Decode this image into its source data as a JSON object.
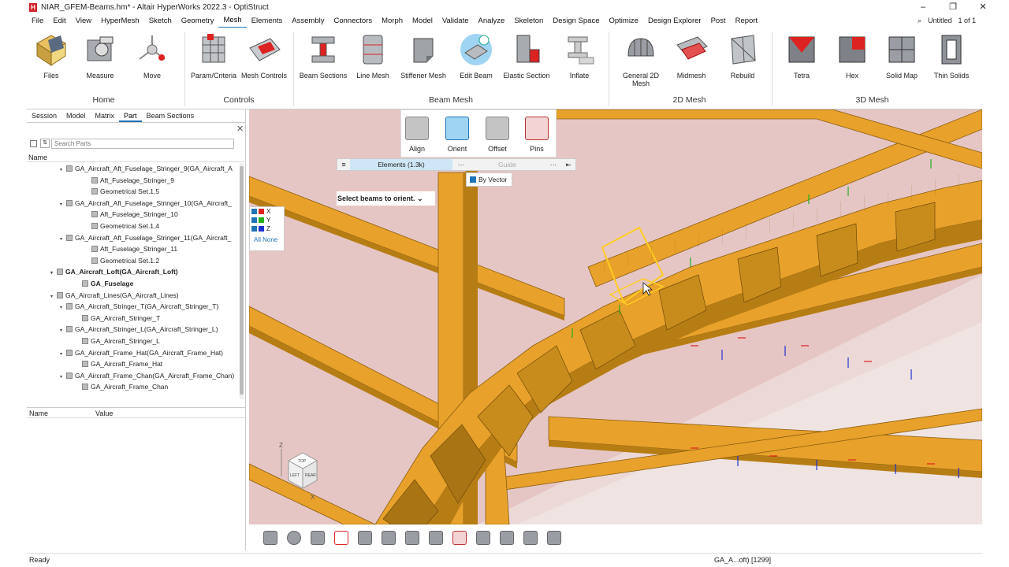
{
  "window": {
    "title": "NIAR_GFEM-Beams.hm* - Altair HyperWorks 2022.3 - OptiStruct",
    "minimize": "–",
    "maximize": "❐",
    "close": "✕"
  },
  "menu": {
    "items": [
      "File",
      "Edit",
      "View",
      "HyperMesh",
      "Sketch",
      "Geometry",
      "Mesh",
      "Elements",
      "Assembly",
      "Connectors",
      "Morph",
      "Model",
      "Validate",
      "Analyze",
      "Skeleton",
      "Design Space",
      "Optimize",
      "Design Explorer",
      "Post",
      "Report"
    ],
    "active": "Mesh",
    "session_name": "Untitled",
    "page_count": "1 of 1"
  },
  "ribbon": {
    "home": {
      "label": "Home",
      "tools": [
        "Files",
        "Measure",
        "Move"
      ]
    },
    "controls": {
      "label": "Controls",
      "tools": [
        "Param/Criteria",
        "Mesh Controls"
      ]
    },
    "beam_mesh": {
      "label": "Beam Mesh",
      "tools": [
        "Beam Sections",
        "Line Mesh",
        "Stiffener Mesh",
        "Edit Beam",
        "Elastic Section",
        "Inflate"
      ]
    },
    "mesh2d": {
      "label": "2D Mesh",
      "tools": [
        "General 2D Mesh",
        "Midmesh",
        "Rebuild"
      ]
    },
    "mesh3d": {
      "label": "3D Mesh",
      "tools": [
        "Tetra",
        "Hex",
        "Solid Map",
        "Thin Solids"
      ]
    }
  },
  "panel": {
    "tabs": [
      "Session",
      "Model",
      "Matrix",
      "Part",
      "Beam Sections"
    ],
    "active_tab": "Part",
    "search_placeholder": "Search Parts",
    "name_header": "Name",
    "prop_name": "Name",
    "prop_value": "Value",
    "tree": [
      {
        "label": "GA_Aircraft_Aft_Fuselage_Stringer_9(GA_Aircraft_A",
        "level": 1,
        "bold": false
      },
      {
        "label": "Aft_Fuselage_Stringer_9",
        "level": 3,
        "bold": false
      },
      {
        "label": "Geometrical Set.1.5",
        "level": 3,
        "bold": false
      },
      {
        "label": "GA_Aircraft_Aft_Fuselage_Stringer_10(GA_Aircraft_",
        "level": 1,
        "bold": false
      },
      {
        "label": "Aft_Fuselage_Stringer_10",
        "level": 3,
        "bold": false
      },
      {
        "label": "Geometrical Set.1.4",
        "level": 3,
        "bold": false
      },
      {
        "label": "GA_Aircraft_Aft_Fuselage_Stringer_11(GA_Aircraft_",
        "level": 1,
        "bold": false
      },
      {
        "label": "Aft_Fuselage_Stringer_11",
        "level": 3,
        "bold": false
      },
      {
        "label": "Geometrical Set.1.2",
        "level": 3,
        "bold": false
      },
      {
        "label": "GA_Aircraft_Loft(GA_Aircraft_Loft)",
        "level": 0,
        "bold": true
      },
      {
        "label": "GA_Fuselage",
        "level": 2,
        "bold": true
      },
      {
        "label": "GA_Aircraft_Lines(GA_Aircraft_Lines)",
        "level": 0,
        "bold": false
      },
      {
        "label": "GA_Aircraft_Stringer_T(GA_Aircraft_Stringer_T)",
        "level": 1,
        "bold": false
      },
      {
        "label": "GA_Aircraft_Stringer_T",
        "level": 2,
        "bold": false
      },
      {
        "label": "GA_Aircraft_Stringer_L(GA_Aircraft_Stringer_L)",
        "level": 1,
        "bold": false
      },
      {
        "label": "GA_Aircraft_Stringer_L",
        "level": 2,
        "bold": false
      },
      {
        "label": "GA_Aircraft_Frame_Hat(GA_Aircraft_Frame_Hat)",
        "level": 1,
        "bold": false
      },
      {
        "label": "GA_Aircraft_Frame_Hat",
        "level": 2,
        "bold": false
      },
      {
        "label": "GA_Aircraft_Frame_Chan(GA_Aircraft_Frame_Chan)",
        "level": 1,
        "bold": false
      },
      {
        "label": "GA_Aircraft_Frame_Chan",
        "level": 2,
        "bold": false
      }
    ]
  },
  "beam_tools": [
    "Align",
    "Orient",
    "Offset",
    "Pins"
  ],
  "selector": {
    "elements": "Elements (1.3k)",
    "guide": "Guide",
    "by_vector": "By Vector",
    "hint": "Select beams to orient.",
    "axes": [
      "X",
      "Y",
      "Z"
    ],
    "axis_colors": [
      "#e02020",
      "#20b020",
      "#2030d0"
    ],
    "all_link": "All",
    "none_link": "None"
  },
  "viewcube": {
    "top": "TOP",
    "left": "LEFT",
    "rear": "REAR",
    "z": "Z",
    "x": "X"
  },
  "status": {
    "ready": "Ready",
    "entity": "GA_A...oft) [1299]"
  },
  "colors": {
    "beam": "#e8a12a",
    "beam_dark": "#b77d15",
    "skin": "#e6c6c4",
    "accent": "#1f73b7"
  }
}
